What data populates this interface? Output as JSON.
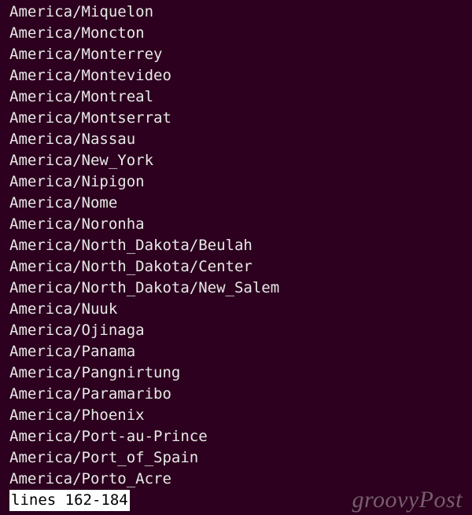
{
  "terminal": {
    "lines": [
      "America/Miquelon",
      "America/Moncton",
      "America/Monterrey",
      "America/Montevideo",
      "America/Montreal",
      "America/Montserrat",
      "America/Nassau",
      "America/New_York",
      "America/Nipigon",
      "America/Nome",
      "America/Noronha",
      "America/North_Dakota/Beulah",
      "America/North_Dakota/Center",
      "America/North_Dakota/New_Salem",
      "America/Nuuk",
      "America/Ojinaga",
      "America/Panama",
      "America/Pangnirtung",
      "America/Paramaribo",
      "America/Phoenix",
      "America/Port-au-Prince",
      "America/Port_of_Spain",
      "America/Porto_Acre"
    ],
    "pager_status": "lines 162-184"
  },
  "watermark": "groovyPost"
}
